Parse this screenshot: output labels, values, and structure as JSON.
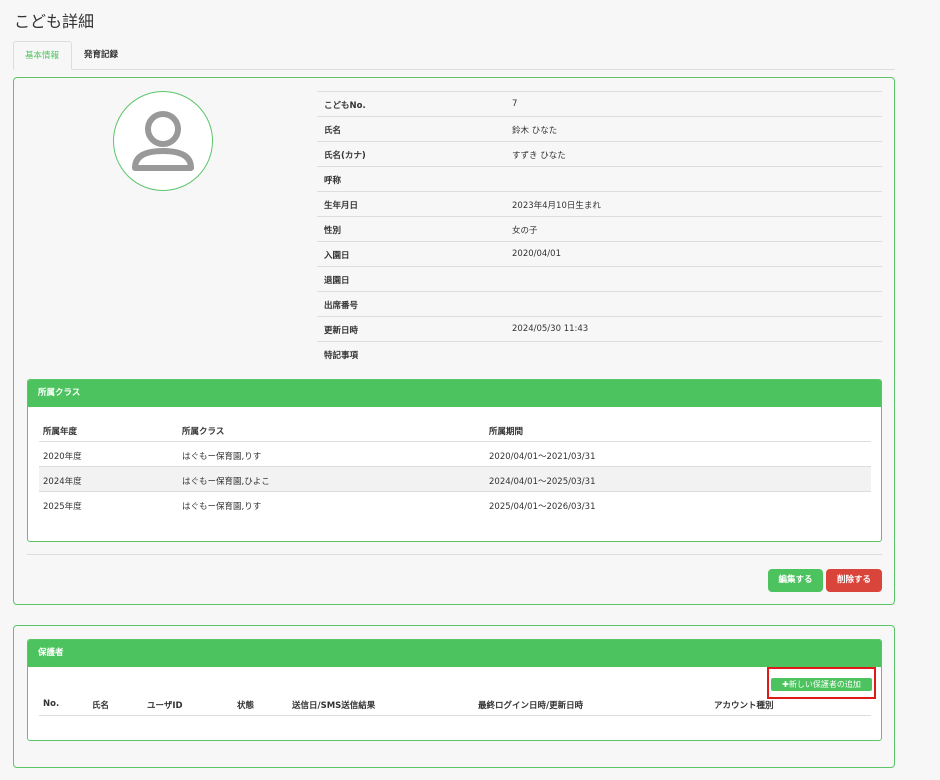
{
  "page": {
    "title": "こども詳細"
  },
  "tabs": [
    {
      "label": "基本情報",
      "active": true
    },
    {
      "label": "発育記録",
      "active": false
    }
  ],
  "child_info": {
    "rows": [
      {
        "label": "こどもNo.",
        "value": "7"
      },
      {
        "label": "氏名",
        "value": "鈴木 ひなた"
      },
      {
        "label": "氏名(カナ)",
        "value": "すずき ひなた"
      },
      {
        "label": "呼称",
        "value": ""
      },
      {
        "label": "生年月日",
        "value": "2023年4月10日生まれ"
      },
      {
        "label": "性別",
        "value": "女の子"
      },
      {
        "label": "入園日",
        "value": "2020/04/01"
      },
      {
        "label": "退園日",
        "value": ""
      },
      {
        "label": "出席番号",
        "value": ""
      },
      {
        "label": "更新日時",
        "value": "2024/05/30 11:43"
      },
      {
        "label": "特記事項",
        "value": ""
      }
    ]
  },
  "class_panel": {
    "title": "所属クラス",
    "columns": [
      "所属年度",
      "所属クラス",
      "所属期間"
    ],
    "rows": [
      [
        "2020年度",
        "はぐもー保育園,りす",
        "2020/04/01～2021/03/31"
      ],
      [
        "2024年度",
        "はぐもー保育園,ひよこ",
        "2024/04/01～2025/03/31"
      ],
      [
        "2025年度",
        "はぐもー保育園,りす",
        "2025/04/01～2026/03/31"
      ]
    ]
  },
  "actions": {
    "edit_label": "編集する",
    "delete_label": "削除する"
  },
  "guardian_panel": {
    "title": "保護者",
    "add_button_label": "✚新しい保護者の追加",
    "columns": [
      "No.",
      "氏名",
      "ユーザID",
      "状態",
      "送信日/SMS送信結果",
      "最終ログイン日時/更新日時",
      "アカウント種別"
    ]
  },
  "colors": {
    "accent": "#4cc35e",
    "danger": "#d9443b",
    "highlight": "#e01919"
  },
  "icons": {
    "avatar": "person-icon"
  }
}
